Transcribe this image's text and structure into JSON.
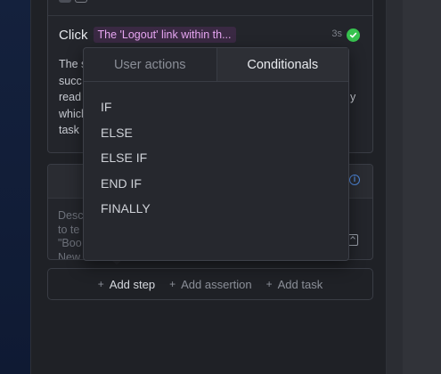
{
  "step": {
    "action": "Click",
    "locator": "The 'Logout' link within th...",
    "duration": "3s",
    "description_lines": [
      "The s",
      "succ",
      "read",
      "which",
      "task"
    ],
    "description_tail": "y",
    "status_color": "#37c24f"
  },
  "assertion": {
    "placeholder_lines": [
      "Desc",
      "to te",
      "\"Boo",
      "New"
    ]
  },
  "add_bar": {
    "add_step": "Add step",
    "add_assertion": "Add assertion",
    "add_task": "Add task"
  },
  "dropdown": {
    "tabs": [
      {
        "label": "User actions",
        "active": false
      },
      {
        "label": "Conditionals",
        "active": true
      }
    ],
    "items": [
      "IF",
      "ELSE",
      "ELSE IF",
      "END IF",
      "FINALLY"
    ]
  },
  "colors": {
    "locator_text": "#e7a6f2",
    "locator_bg": "#3a2943",
    "info_accent": "#4f87d9"
  },
  "icons": {
    "status": "check-circle-icon",
    "info": "info-icon",
    "expand": "expand-icon",
    "plus": "plus-icon"
  }
}
